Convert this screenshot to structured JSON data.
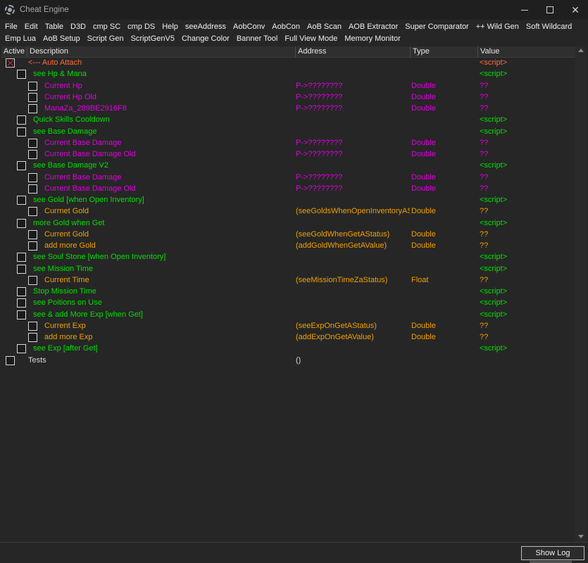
{
  "window": {
    "title": "Cheat Engine",
    "icon": "cheat-engine-logo"
  },
  "menu": {
    "row1": [
      "File",
      "Edit",
      "Table",
      "D3D",
      "cmp SC",
      "cmp DS",
      "Help",
      "seeAddress",
      "AobConv",
      "AobCon",
      "AoB Scan",
      "AOB Extractor",
      "Super Comparator",
      "++ Wild Gen",
      "Soft Wildcard"
    ],
    "row2": [
      "Emp Lua",
      "AoB Setup",
      "Script Gen",
      "ScriptGenV5",
      "Change Color",
      "Banner Tool",
      "Full View Mode",
      "Memory Monitor"
    ]
  },
  "columns": {
    "active": "Active",
    "description": "Description",
    "address": "Address",
    "type": "Type",
    "value": "Value"
  },
  "colors": {
    "script": "#00e000",
    "pointer": "#e000e0",
    "static": "#f0a000",
    "attach": "#ff6a3a",
    "plain": "#d8d8d8"
  },
  "rows": [
    {
      "level": 0,
      "checked": true,
      "description": "<--- Auto Attach",
      "address": "",
      "type": "",
      "value": "<script>",
      "color": "attach"
    },
    {
      "level": 1,
      "checked": false,
      "description": "see Hp & Mana",
      "address": "",
      "type": "",
      "value": "<script>",
      "color": "script"
    },
    {
      "level": 2,
      "checked": false,
      "description": "Current Hp",
      "address": "P->????????",
      "type": "Double",
      "value": "??",
      "color": "pointer"
    },
    {
      "level": 2,
      "checked": false,
      "description": "Current Hp Old",
      "address": "P->????????",
      "type": "Double",
      "value": "??",
      "color": "pointer"
    },
    {
      "level": 2,
      "checked": false,
      "description": "ManaZa_289BE2916F8",
      "address": "P->????????",
      "type": "Double",
      "value": "??",
      "color": "pointer"
    },
    {
      "level": 1,
      "checked": false,
      "description": "Quick Skills Cooldown",
      "address": "",
      "type": "",
      "value": "<script>",
      "color": "script"
    },
    {
      "level": 1,
      "checked": false,
      "description": "see Base Damage",
      "address": "",
      "type": "",
      "value": "<script>",
      "color": "script"
    },
    {
      "level": 2,
      "checked": false,
      "description": "Current Base Damage",
      "address": "P->????????",
      "type": "Double",
      "value": "??",
      "color": "pointer"
    },
    {
      "level": 2,
      "checked": false,
      "description": "Current Base Damage Old",
      "address": "P->????????",
      "type": "Double",
      "value": "??",
      "color": "pointer"
    },
    {
      "level": 1,
      "checked": false,
      "description": "see Base Damage V2",
      "address": "",
      "type": "",
      "value": "<script>",
      "color": "script"
    },
    {
      "level": 2,
      "checked": false,
      "description": "Current Base Damage",
      "address": "P->????????",
      "type": "Double",
      "value": "??",
      "color": "pointer"
    },
    {
      "level": 2,
      "checked": false,
      "description": "Current Base Damage Old",
      "address": "P->????????",
      "type": "Double",
      "value": "??",
      "color": "pointer"
    },
    {
      "level": 1,
      "checked": false,
      "description": "see Gold [when Open Inventory]",
      "address": "",
      "type": "",
      "value": "<script>",
      "color": "script"
    },
    {
      "level": 2,
      "checked": false,
      "description": "Currnet Gold",
      "address": "(seeGoldsWhenOpenInventoryAStatus)",
      "type": "Double",
      "value": "??",
      "color": "static"
    },
    {
      "level": 1,
      "checked": false,
      "description": "more Gold when Get",
      "address": "",
      "type": "",
      "value": "<script>",
      "color": "script"
    },
    {
      "level": 2,
      "checked": false,
      "description": "Current Gold",
      "address": "(seeGoldWhenGetAStatus)",
      "type": "Double",
      "value": "??",
      "color": "static"
    },
    {
      "level": 2,
      "checked": false,
      "description": "add more Gold",
      "address": "(addGoldWhenGetAValue)",
      "type": "Double",
      "value": "??",
      "color": "static"
    },
    {
      "level": 1,
      "checked": false,
      "description": "see Soul Stone [when Open Inventory]",
      "address": "",
      "type": "",
      "value": "<script>",
      "color": "script"
    },
    {
      "level": 1,
      "checked": false,
      "description": "see Mission Time",
      "address": "",
      "type": "",
      "value": "<script>",
      "color": "script"
    },
    {
      "level": 2,
      "checked": false,
      "description": "Current Time",
      "address": "(seeMissionTimeZaStatus)",
      "type": "Float",
      "value": "??",
      "color": "static"
    },
    {
      "level": 1,
      "checked": false,
      "description": "Stop Mission Time",
      "address": "",
      "type": "",
      "value": "<script>",
      "color": "script"
    },
    {
      "level": 1,
      "checked": false,
      "description": "see Poitions on Use",
      "address": "",
      "type": "",
      "value": "<script>",
      "color": "script"
    },
    {
      "level": 1,
      "checked": false,
      "description": "see & add More Exp [when Get]",
      "address": "",
      "type": "",
      "value": "<script>",
      "color": "script"
    },
    {
      "level": 2,
      "checked": false,
      "description": "Current Exp",
      "address": "(seeExpOnGetAStatus)",
      "type": "Double",
      "value": "??",
      "color": "static"
    },
    {
      "level": 2,
      "checked": false,
      "description": "add more Exp",
      "address": "(addExpOnGetAValue)",
      "type": "Double",
      "value": "??",
      "color": "static"
    },
    {
      "level": 1,
      "checked": false,
      "description": "see Exp [after Get]",
      "address": "",
      "type": "",
      "value": "<script>",
      "color": "script"
    },
    {
      "level": 0,
      "checked": false,
      "description": "Tests",
      "address": "()",
      "type": "",
      "value": "",
      "color": "plain"
    }
  ],
  "footer": {
    "show_log": "Show Log"
  }
}
